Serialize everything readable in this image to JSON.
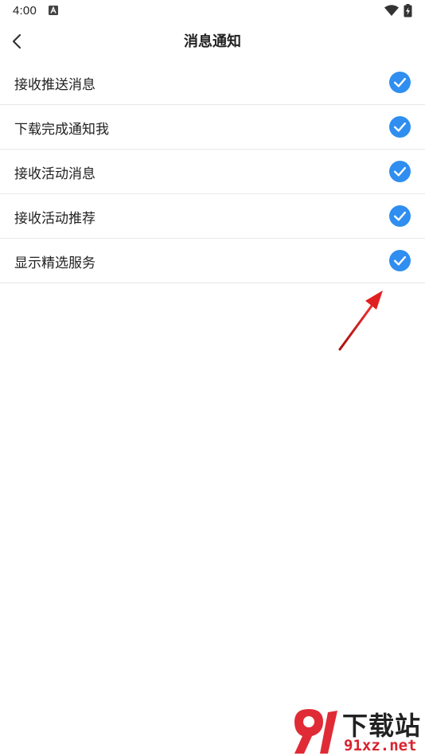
{
  "status_bar": {
    "time": "4:00",
    "icons": [
      "a-notification-icon",
      "wifi-icon",
      "battery-charging-icon"
    ]
  },
  "header": {
    "title": "消息通知",
    "back_icon": "chevron-left-icon"
  },
  "settings": [
    {
      "label": "接收推送消息",
      "checked": true
    },
    {
      "label": "下载完成通知我",
      "checked": true
    },
    {
      "label": "接收活动消息",
      "checked": true
    },
    {
      "label": "接收活动推荐",
      "checked": true
    },
    {
      "label": "显示精选服务",
      "checked": true
    }
  ],
  "watermark": {
    "title": "下载站",
    "domain": "91xz.net"
  },
  "colors": {
    "accent": "#2f8ef0",
    "annotation": "#e02020",
    "watermark_red": "#d9232e"
  }
}
